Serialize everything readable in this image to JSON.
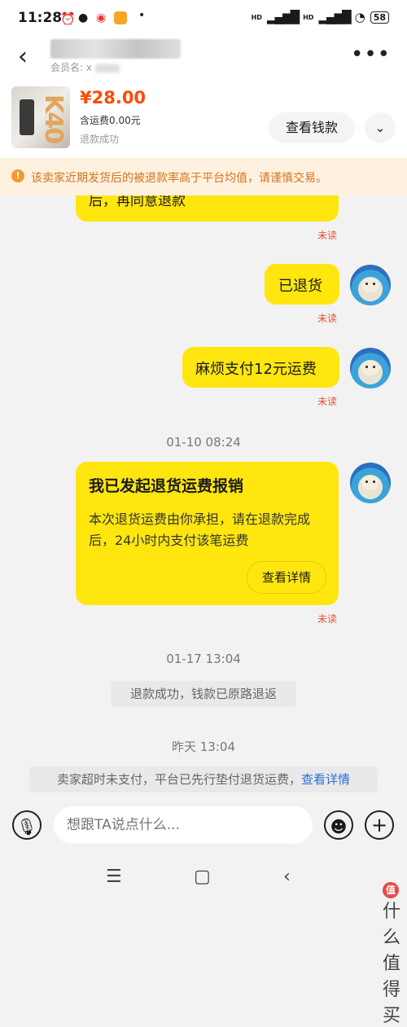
{
  "status_bar": {
    "time": "11:28",
    "signal1": "HD",
    "signal2": "HD",
    "battery": "58"
  },
  "header": {
    "member_label": "会员名: x"
  },
  "product": {
    "image_text": "K40",
    "price": "¥28.00",
    "shipping": "含运费0.00元",
    "status": "退款成功",
    "view_payment_button": "查看钱款"
  },
  "warning": {
    "text": "该卖家近期发货后的被退款率高于平台均值，请谨慎交易。"
  },
  "messages": [
    {
      "text": "后，再同意退款",
      "status": "未读"
    },
    {
      "text": "已退货",
      "status": "未读"
    },
    {
      "text": "麻烦支付12元运费",
      "status": "未读"
    }
  ],
  "timestamps": [
    "01-10 08:24",
    "01-17 13:04",
    "昨天 13:04"
  ],
  "card": {
    "title": "我已发起退货运费报销",
    "body": "本次退货运费由你承担，请在退款完成后，24小时内支付该笔运费",
    "button": "查看详情",
    "status": "未读"
  },
  "system_messages": {
    "refund": "退款成功，钱款已原路退返",
    "seller_timeout": "卖家超时未支付，平台已先行垫付退货运费，",
    "seller_timeout_link": "查看详情"
  },
  "input_bar": {
    "placeholder": "想跟TA说点什么..."
  },
  "watermark": "什么值得买"
}
